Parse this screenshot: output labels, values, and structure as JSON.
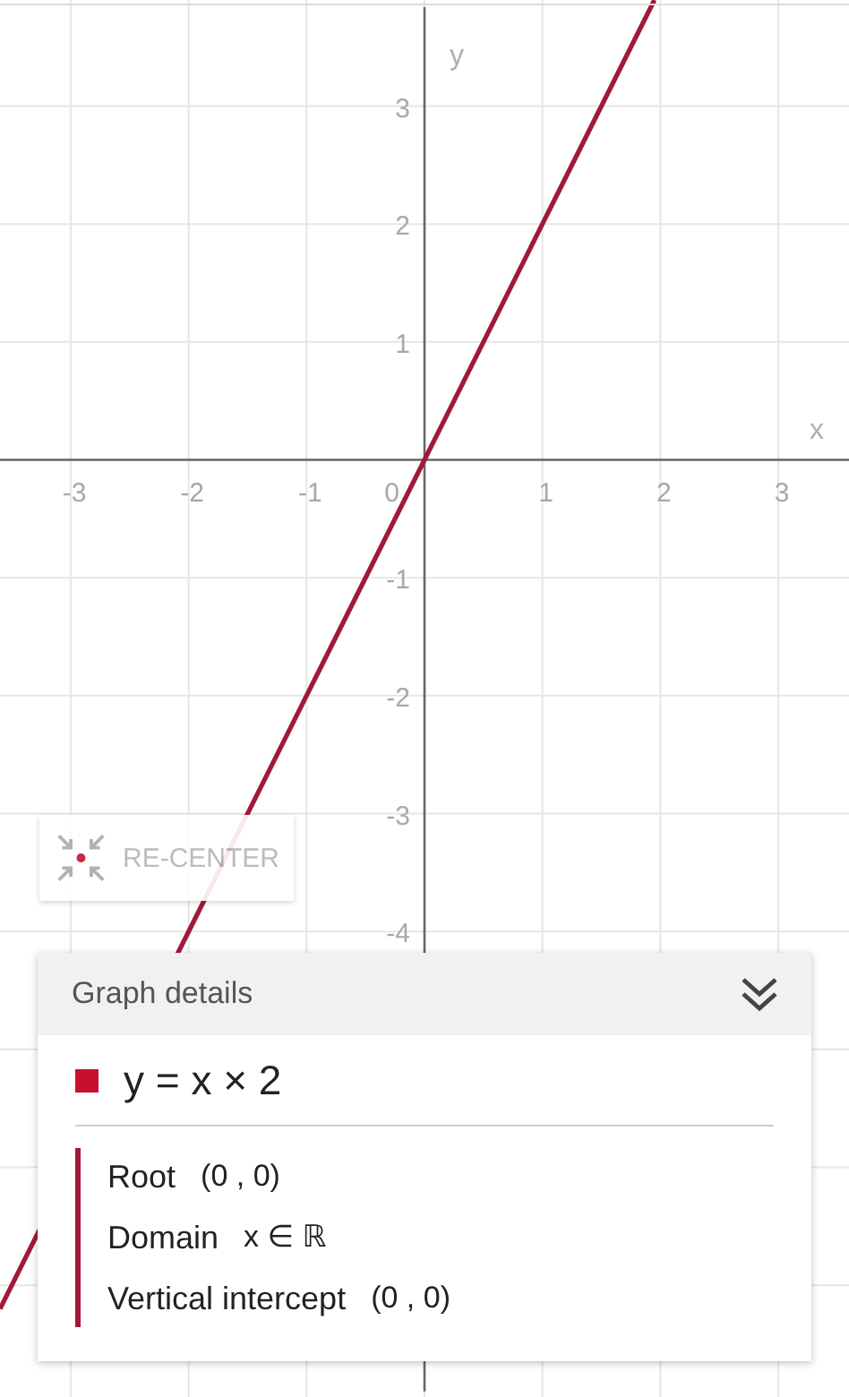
{
  "graph": {
    "origin_label": "0",
    "chart_data": {
      "type": "line",
      "grid": true,
      "xlabel": "x",
      "ylabel": "y",
      "x": [
        -3.6,
        1.95
      ],
      "series": [
        {
          "color": "#a3173a",
          "values": [
            -7.2,
            3.9
          ]
        }
      ],
      "xlim": [
        -3.6,
        3.6
      ],
      "ylim": [
        -7.9,
        3.9
      ],
      "xticks": [
        -3,
        -2,
        -1,
        1,
        2,
        3
      ],
      "yticks": [
        -4,
        -3,
        -2,
        -1,
        1,
        2,
        3
      ]
    }
  },
  "recenter_button": {
    "label": "RE-CENTER"
  },
  "details": {
    "title": "Graph details",
    "equation": {
      "text": "y = x × 2",
      "color": "#c8102e"
    },
    "properties": [
      {
        "label": "Root",
        "value": "(0 , 0)"
      },
      {
        "label": "Domain",
        "value": "x ∈ ℝ"
      },
      {
        "label": "Vertical intercept",
        "value": "(0 , 0)"
      }
    ]
  }
}
